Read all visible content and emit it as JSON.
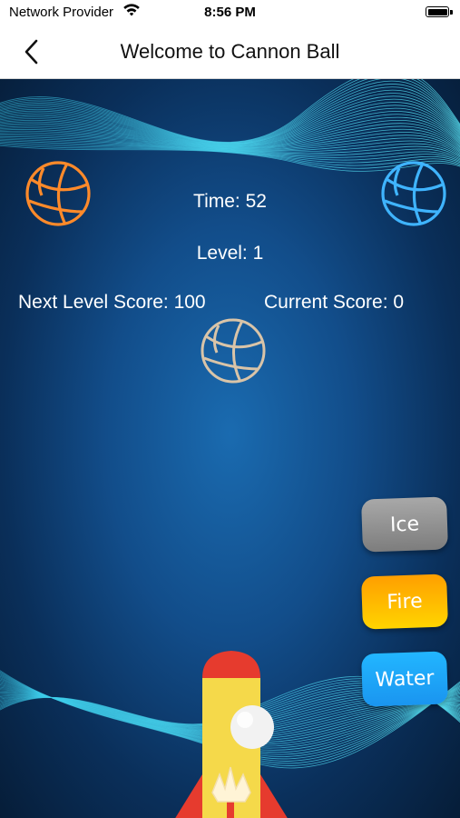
{
  "status_bar": {
    "carrier": "Network Provider",
    "time": "8:56 PM",
    "wifi_icon": "wifi-icon",
    "battery_icon": "battery-full-icon"
  },
  "nav": {
    "back_icon": "chevron-left-icon",
    "title": "Welcome to Cannon Ball"
  },
  "hud": {
    "time_text": "Time: 52",
    "level_text": "Level: 1",
    "next_level_score_text": "Next Level Score: 100",
    "current_score_text": "Current Score: 0"
  },
  "balls": [
    {
      "name": "fire-basketball",
      "color": "#ff8a2a"
    },
    {
      "name": "water-basketball",
      "color": "#3fb4ff"
    },
    {
      "name": "ice-basketball",
      "color": "#d9c4a8"
    }
  ],
  "buttons": {
    "ice": {
      "label": "Ice",
      "color": "#8f8f8f"
    },
    "fire": {
      "label": "Fire",
      "color": "#ffb800"
    },
    "water": {
      "label": "Water",
      "color": "#1ea8ff"
    }
  },
  "colors": {
    "background_center": "#1a6bb0",
    "background_edge": "#061d38",
    "wave": "#3fd6f0",
    "rocket_red": "#e63b2e",
    "rocket_yellow": "#f5d94a",
    "cannon_ball": "#f2f2f2"
  }
}
